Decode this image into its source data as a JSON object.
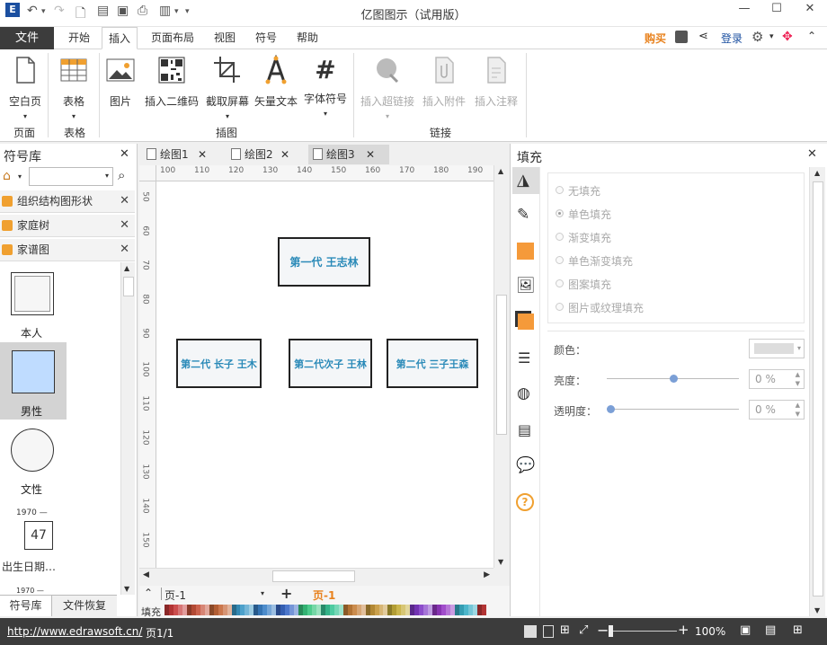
{
  "app": {
    "title": "亿图图示（试用版）",
    "buy": "购买",
    "login": "登录"
  },
  "menu": {
    "file": "文件",
    "tabs": [
      "开始",
      "插入",
      "页面布局",
      "视图",
      "符号",
      "帮助"
    ],
    "active": "插入"
  },
  "ribbon": {
    "buttons": [
      {
        "label": "空白页",
        "icon": "blank-page-icon"
      },
      {
        "label": "表格",
        "icon": "table-icon"
      },
      {
        "label": "图片",
        "icon": "picture-icon"
      },
      {
        "label": "插入二维码",
        "icon": "qr-code-icon"
      },
      {
        "label": "截取屏幕",
        "icon": "crop-icon"
      },
      {
        "label": "矢量文本",
        "icon": "vector-text-icon"
      },
      {
        "label": "字体符号",
        "icon": "hash-icon"
      },
      {
        "label": "插入超链接",
        "icon": "globe-link-icon"
      },
      {
        "label": "插入附件",
        "icon": "attachment-icon"
      },
      {
        "label": "插入注释",
        "icon": "note-icon"
      }
    ],
    "groups": [
      "页面",
      "表格",
      "插图",
      "链接"
    ]
  },
  "left_panel": {
    "title": "符号库",
    "libraries": [
      "组织结构图形状",
      "家庭树",
      "家谱图"
    ],
    "shapes": [
      "本人",
      "男性",
      "文性",
      "出生日期…"
    ],
    "date_year": "1970 —",
    "date_value": "47",
    "date_year2": "1970 —",
    "bottom_tabs": [
      "符号库",
      "文件恢复"
    ]
  },
  "doc_tabs": [
    "绘图1",
    "绘图2",
    "绘图3"
  ],
  "rulers": {
    "top": [
      "100",
      "110",
      "120",
      "130",
      "140",
      "150",
      "160",
      "170",
      "180",
      "190"
    ],
    "left": [
      "50",
      "60",
      "70",
      "80",
      "90",
      "100",
      "110",
      "120",
      "130",
      "140",
      "150"
    ]
  },
  "diagram": {
    "nodes": [
      "第一代 王志林",
      "第二代 长子 王木",
      "第二代次子 王林",
      "第二代 三子王森"
    ]
  },
  "page_bar": {
    "page_select": "页-1",
    "page_label": "页-1",
    "fill_label": "填充"
  },
  "right_panel": {
    "title": "填充",
    "options": [
      "无填充",
      "单色填充",
      "渐变填充",
      "单色渐变填充",
      "图案填充",
      "图片或纹理填充"
    ],
    "selected": "单色填充",
    "color_label": "颜色：",
    "brightness_label": "亮度：",
    "brightness_value": "0 %",
    "transparency_label": "透明度：",
    "transparency_value": "0 %"
  },
  "status": {
    "url": "http://www.edrawsoft.cn/",
    "page": "页1/1",
    "zoom": "100%"
  },
  "colors": {
    "accent_orange": "#e8821e",
    "node_text": "#2a8ab8",
    "file_tab": "#3c3c3c",
    "male_fill": "#bfdcff"
  }
}
